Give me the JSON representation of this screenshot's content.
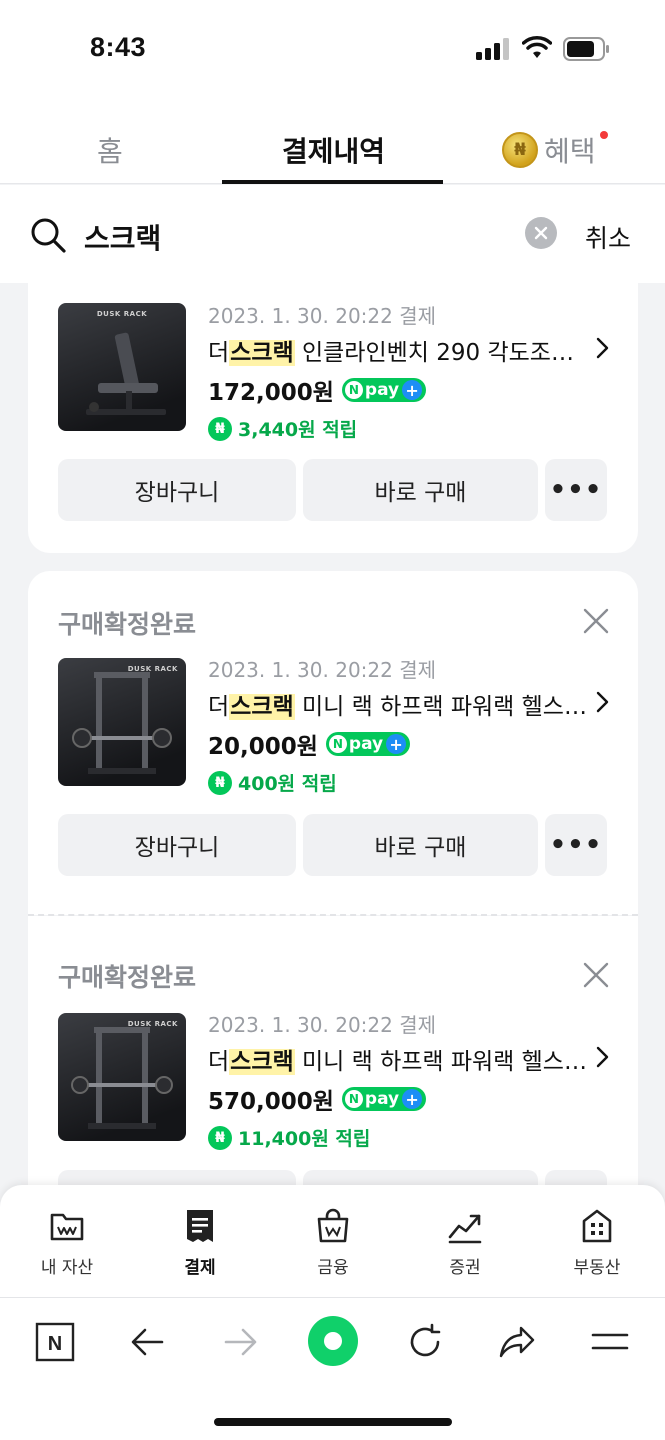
{
  "status_bar": {
    "time": "8:43"
  },
  "tabs": {
    "home": "홈",
    "payments": "결제내역",
    "benefits": "혜택"
  },
  "search": {
    "query": "스크랙",
    "cancel_label": "취소"
  },
  "orders": [
    {
      "status": "",
      "brand_text": "DUSK RACK",
      "date": "2023. 1. 30. 20:22 결제",
      "name_highlight": "스크랙",
      "name_prefix": "더",
      "name_rest": " 인클라인벤치 290 각도조절...",
      "price": "172,000원",
      "reward": "3,440원 적립"
    },
    {
      "status": "구매확정완료",
      "brand_text": "DUSK RACK",
      "date": "2023. 1. 30. 20:22 결제",
      "name_highlight": "스크랙",
      "name_prefix": "더",
      "name_rest": " 미니 랙 하프랙 파워랙 헬스 ...",
      "price": "20,000원",
      "reward": "400원 적립"
    },
    {
      "status": "구매확정완료",
      "brand_text": "DUSK RACK",
      "date": "2023. 1. 30. 20:22 결제",
      "name_highlight": "스크랙",
      "name_prefix": "더",
      "name_rest": " 미니 랙 하프랙 파워랙 헬스 ...",
      "price": "570,000원",
      "reward": "11,400원 적립"
    }
  ],
  "buttons": {
    "cart": "장바구니",
    "buy_now": "바로 구매",
    "more": "•••"
  },
  "npay": {
    "text": "pay",
    "n": "N",
    "plus": "+"
  },
  "bottom_nav": {
    "items": [
      {
        "label": "내 자산",
        "icon": "wallet-icon"
      },
      {
        "label": "결제",
        "icon": "receipt-icon"
      },
      {
        "label": "금융",
        "icon": "bag-icon"
      },
      {
        "label": "증권",
        "icon": "stock-chart-icon"
      },
      {
        "label": "부동산",
        "icon": "building-icon"
      }
    ]
  },
  "browser_bar": {
    "logo": "N"
  },
  "colors": {
    "accent_green": "#03c75a",
    "reward_green": "#06a84a",
    "highlight": "#fff3a8"
  }
}
